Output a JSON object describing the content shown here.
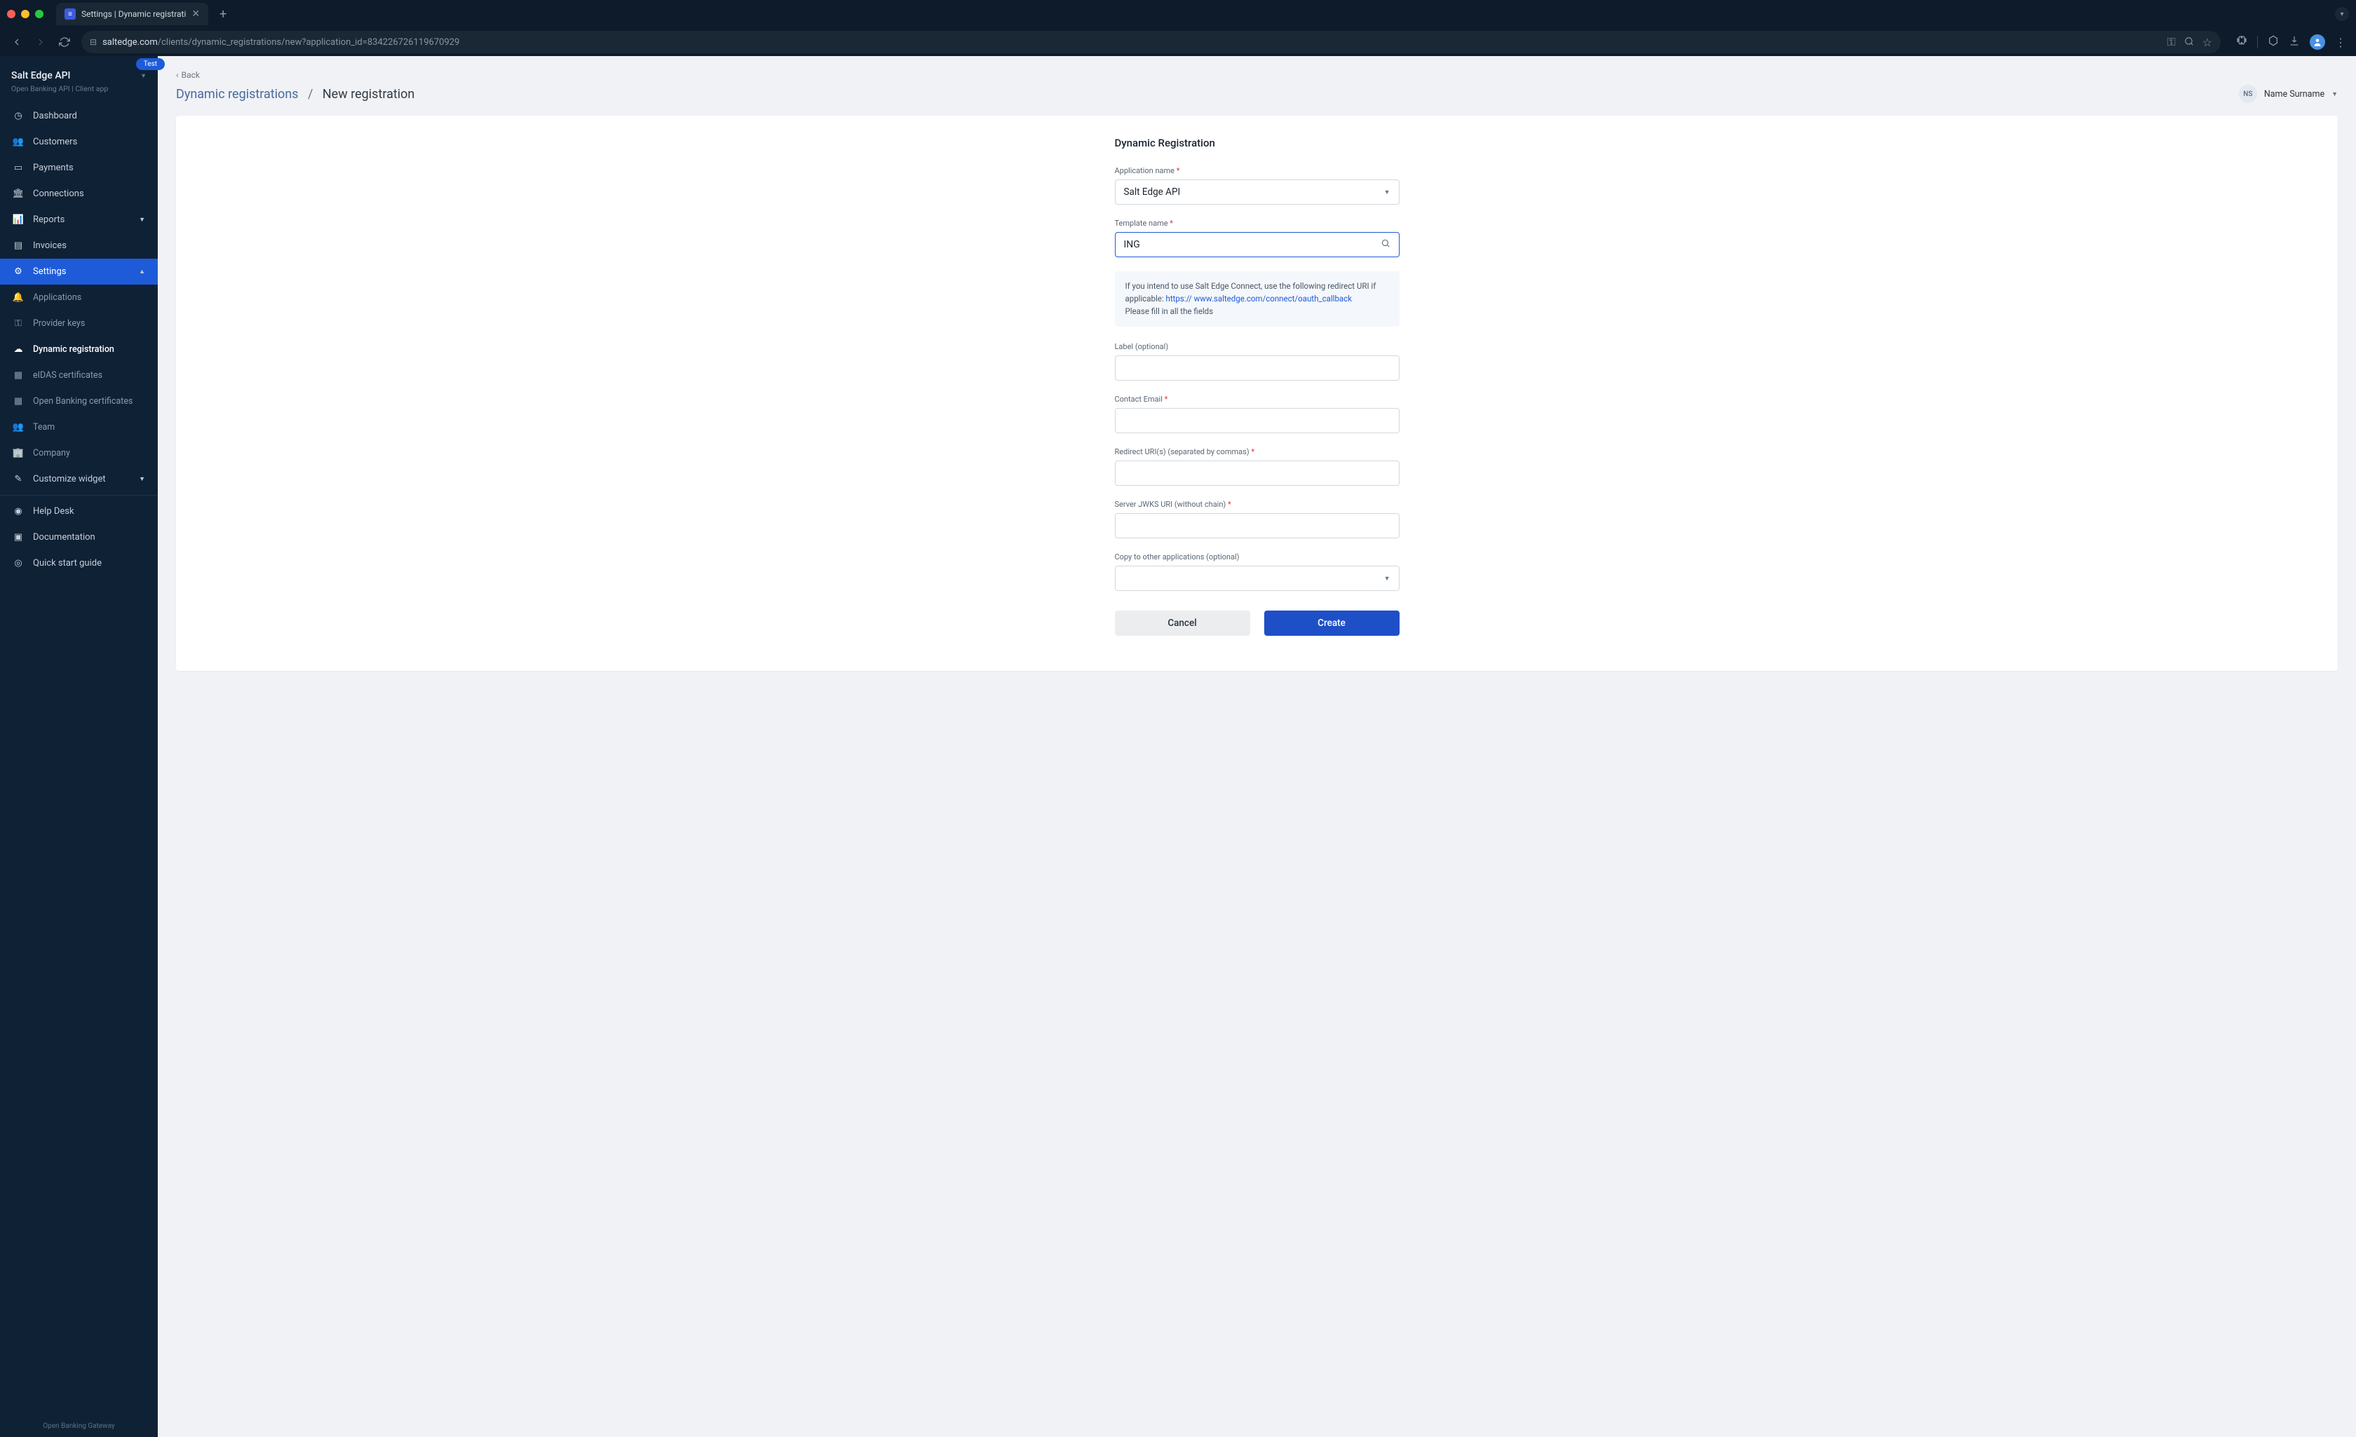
{
  "browser": {
    "tab_title": "Settings | Dynamic registrati",
    "url_host": "saltedge.com",
    "url_path": "/clients/dynamic_registrations/new?application_id=834226726119670929"
  },
  "sidebar": {
    "env_badge": "Test",
    "title": "Salt Edge API",
    "subtitle": "Open Banking API | Client app",
    "items": [
      {
        "label": "Dashboard",
        "icon": "speedometer"
      },
      {
        "label": "Customers",
        "icon": "people"
      },
      {
        "label": "Payments",
        "icon": "card"
      },
      {
        "label": "Connections",
        "icon": "bank"
      },
      {
        "label": "Reports",
        "icon": "chart",
        "expandable": true
      },
      {
        "label": "Invoices",
        "icon": "doc"
      },
      {
        "label": "Settings",
        "icon": "gear",
        "active": true,
        "expanded": true
      }
    ],
    "sub_items": [
      {
        "label": "Applications"
      },
      {
        "label": "Provider keys"
      },
      {
        "label": "Dynamic registration",
        "current": true
      },
      {
        "label": "eIDAS certificates"
      },
      {
        "label": "Open Banking certificates"
      },
      {
        "label": "Team"
      },
      {
        "label": "Company"
      }
    ],
    "customize": {
      "label": "Customize widget"
    },
    "bottom": [
      {
        "label": "Help Desk",
        "icon": "help"
      },
      {
        "label": "Documentation",
        "icon": "docs"
      },
      {
        "label": "Quick start guide",
        "icon": "check"
      }
    ],
    "footer": "Open Banking Gateway"
  },
  "header": {
    "back": "Back",
    "breadcrumb_parent": "Dynamic registrations",
    "sep": "/",
    "breadcrumb_current": "New registration",
    "user_initials": "NS",
    "user_name": "Name Surname"
  },
  "form": {
    "title": "Dynamic Registration",
    "app_name_label": "Application name",
    "app_name_value": "Salt Edge API",
    "template_label": "Template name",
    "template_value": "ING",
    "info_text1": "If you intend to use Salt Edge Connect, use the following redirect URI if applicable: ",
    "info_link": "https:// www.saltedge.com/connect/oauth_callback",
    "info_text2": "Please fill in all the fields",
    "label_label": "Label (optional)",
    "email_label": "Contact Email",
    "redirect_label": "Redirect URI(s) (separated by commas)",
    "jwks_label": "Server JWKS URI (without chain)",
    "copy_label": "Copy to other applications (optional)",
    "cancel": "Cancel",
    "create": "Create"
  }
}
